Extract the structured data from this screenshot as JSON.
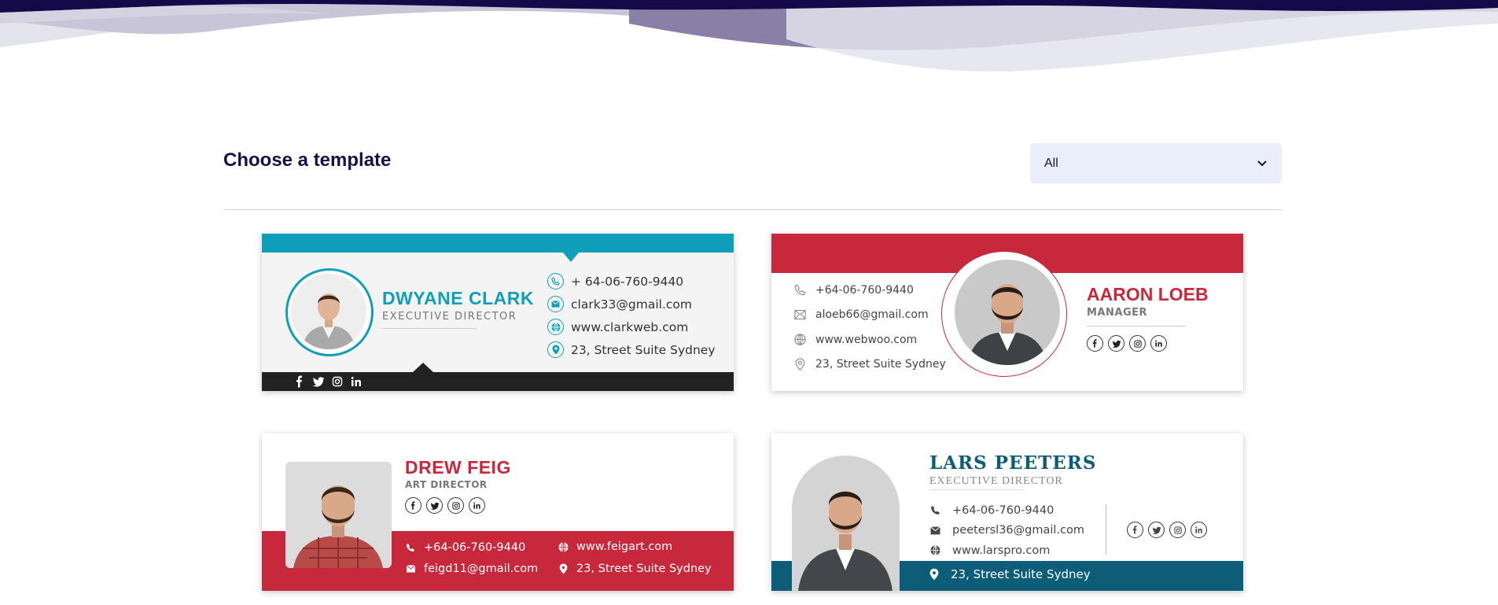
{
  "page": {
    "heading": "Choose a template",
    "filter": {
      "value": "All",
      "icon": "chevron-down-icon"
    }
  },
  "colors": {
    "navy": "#16104a",
    "teal": "#109ebb",
    "crimson": "#c8283c",
    "petrol": "#0d5c78",
    "filter_bg": "#e9eefa"
  },
  "templates": [
    {
      "name": "DWYANE CLARK",
      "title": "EXECUTIVE DIRECTOR",
      "phone": "+ 64-06-760-9440",
      "email": "clark33@gmail.com",
      "web": "www.clarkweb.com",
      "address": "23, Street Suite Sydney",
      "social": [
        "facebook-icon",
        "twitter-icon",
        "instagram-icon",
        "linkedin-icon"
      ]
    },
    {
      "name": "AARON LOEB",
      "title": "MANAGER",
      "phone": "+64-06-760-9440",
      "email": "aloeb66@gmail.com",
      "web": "www.webwoo.com",
      "address": "23, Street Suite Sydney",
      "social": [
        "facebook-icon",
        "twitter-icon",
        "instagram-icon",
        "linkedin-icon"
      ]
    },
    {
      "name": "DREW FEIG",
      "title": "ART DIRECTOR",
      "phone": "+64-06-760-9440",
      "email": "feigd11@gmail.com",
      "web": "www.feigart.com",
      "address": "23, Street Suite Sydney",
      "social": [
        "facebook-icon",
        "twitter-icon",
        "instagram-icon",
        "linkedin-icon"
      ]
    },
    {
      "name": "LARS PEETERS",
      "title": "EXECUTIVE DIRECTOR",
      "phone": "+64-06-760-9440",
      "email": "peetersl36@gmail.com",
      "web": "www.larspro.com",
      "address": "23, Street Suite Sydney",
      "social": [
        "facebook-icon",
        "twitter-icon",
        "instagram-icon",
        "linkedin-icon"
      ]
    }
  ]
}
